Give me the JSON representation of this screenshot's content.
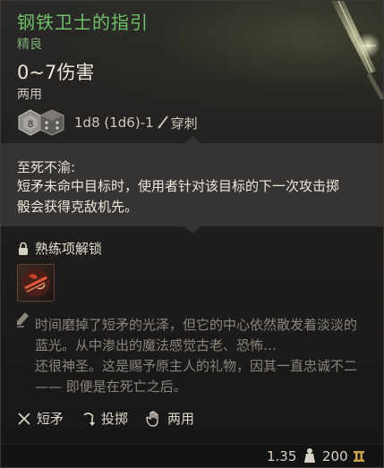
{
  "item": {
    "name": "钢铁卫士的指引",
    "rarity": "精良",
    "damage": "0~7伤害",
    "handedness": "两用",
    "dice": {
      "die1_face": "8",
      "die2_face": "",
      "formula": "1d8 (1d6)-1",
      "damage_type_icon": "piercing-icon",
      "damage_type": "穿刺"
    }
  },
  "passive": {
    "title": "至死不渝:",
    "description": "短矛未命中目标时，使用者针对该目标的下一次攻击掷骰会获得克敌机先。"
  },
  "mastery": {
    "label": "熟练项解锁",
    "icon": "lock-icon",
    "actions": [
      {
        "icon": "weapon-action-icon"
      }
    ]
  },
  "flavor": {
    "line1": "时间磨掉了短矛的光泽，但它的中心依然散发着淡淡的蓝光。从中渗出的魔法感觉古老、恐怖…",
    "line2": "还很神圣。这是赐予原主人的礼物，因其一直忠诚不二 —— 即便是在死亡之后。"
  },
  "properties": [
    {
      "icon": "crossed-weapons-icon",
      "label": "短矛"
    },
    {
      "icon": "throw-icon",
      "label": "投掷"
    },
    {
      "icon": "hand-icon",
      "label": "两用"
    }
  ],
  "footer": {
    "weight": "1.35",
    "price": "200"
  },
  "colors": {
    "name_green": "#6fc06b",
    "rarity_green": "#7fae78",
    "flavor_gray": "#8a847b",
    "band_bg": "#363432"
  }
}
